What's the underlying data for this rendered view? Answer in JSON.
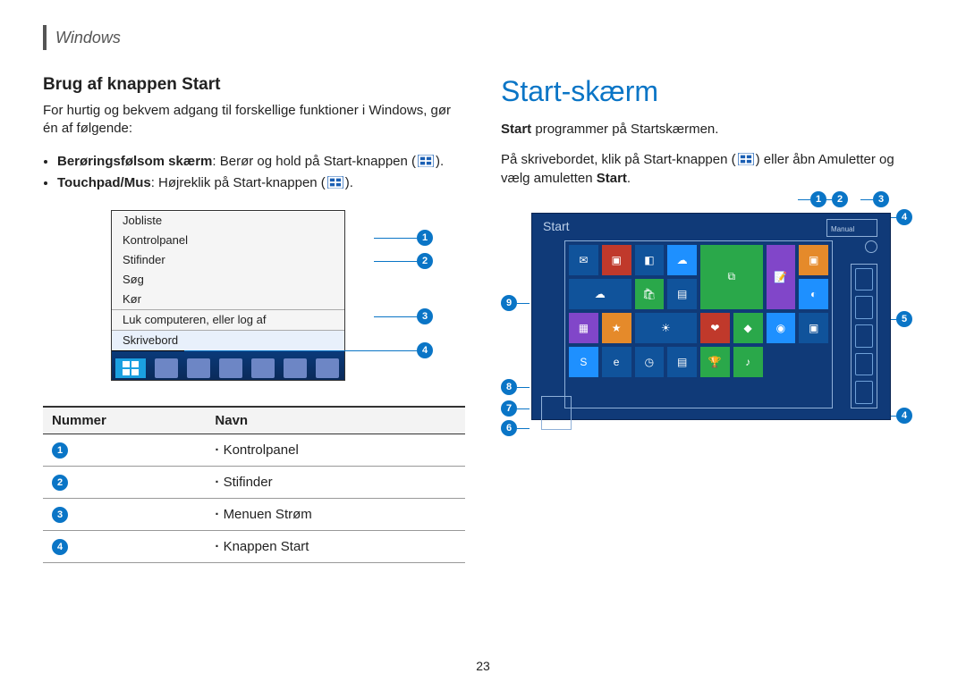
{
  "header": {
    "section": "Windows"
  },
  "left": {
    "heading": "Brug af knappen Start",
    "intro": "For hurtig og bekvem adgang til forskellige funktioner i Windows, gør én af følgende:",
    "bullet1_bold": "Berøringsfølsom skærm",
    "bullet1_rest": ": Berør og hold på Start-knappen (",
    "bullet1_close": ").",
    "bullet2_bold": "Touchpad/Mus",
    "bullet2_rest": ": Højreklik på Start-knappen (",
    "bullet2_close": ").",
    "ctx_menu": {
      "items": [
        "Jobliste",
        "Kontrolpanel",
        "Stifinder",
        "Søg",
        "Kør",
        "Luk computeren, eller log af",
        "Skrivebord"
      ],
      "selected_index": 6
    },
    "ctx_badges": [
      "1",
      "2",
      "3",
      "4"
    ],
    "table": {
      "cols": [
        "Nummer",
        "Navn"
      ],
      "rows": [
        {
          "num": "1",
          "name": "Kontrolpanel"
        },
        {
          "num": "2",
          "name": "Stifinder"
        },
        {
          "num": "3",
          "name": "Menuen Strøm"
        },
        {
          "num": "4",
          "name": "Knappen Start"
        }
      ]
    }
  },
  "right": {
    "heading": "Start-skærm",
    "line1_bold": "Start",
    "line1_rest": " programmer på Startskærmen.",
    "line2_a": "På skrivebordet, klik på Start-knappen (",
    "line2_b": ") eller åbn Amuletter og vælg amuletten ",
    "line2_bold": "Start",
    "line2_c": ".",
    "start_screen": {
      "title": "Start",
      "user_box": "Manual"
    },
    "callouts": [
      "1",
      "2",
      "3",
      "4",
      "5",
      "6",
      "7",
      "8",
      "9"
    ]
  },
  "page_number": "23"
}
